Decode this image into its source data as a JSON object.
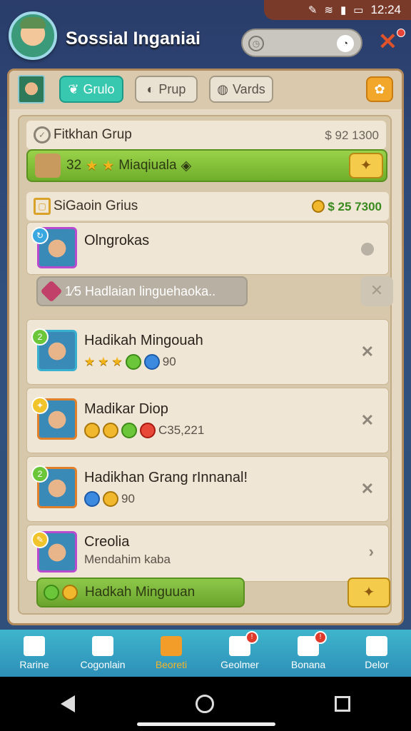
{
  "status": {
    "time": "12:24"
  },
  "header": {
    "title": "Sossial Inganiai"
  },
  "tabs": [
    {
      "label": "Grulo",
      "active": true
    },
    {
      "label": "Prup",
      "active": false
    },
    {
      "label": "Vards",
      "active": false
    }
  ],
  "section1": {
    "title": "Fitkhan Grup",
    "amount": "$ 92 1300"
  },
  "banner1": {
    "count": "32",
    "label": "Miaqiuala"
  },
  "section2": {
    "title": "SiGaoin Grius",
    "amount": "25 7300",
    "currency": "$"
  },
  "rows": [
    {
      "name": "Olngrokas",
      "sub": ""
    },
    {
      "name": "Hadikah Mingouah",
      "sub": "90"
    },
    {
      "name": "Madikar Diop",
      "sub": "C35,221"
    },
    {
      "name": "Hadikhan Grang rInnanal!",
      "sub": "90"
    },
    {
      "name": "Creolia",
      "sub": "Mendahim kaba"
    }
  ],
  "notice": {
    "text": "1⁄5 Hadlaian linguehaoka.."
  },
  "banner2": {
    "label": "Hadkah Minguuan"
  },
  "nav": [
    {
      "label": "Rarine",
      "icon": "home-icon",
      "active": false,
      "badge": ""
    },
    {
      "label": "Cogonlain",
      "icon": "community-icon",
      "active": false,
      "badge": ""
    },
    {
      "label": "Beoreti",
      "icon": "shop-icon",
      "active": true,
      "badge": ""
    },
    {
      "label": "Geolmer",
      "icon": "inbox-icon",
      "active": false,
      "badge": "!"
    },
    {
      "label": "Bonana",
      "icon": "gift-icon",
      "active": false,
      "badge": "!"
    },
    {
      "label": "Delor",
      "icon": "menu-icon",
      "active": false,
      "badge": ""
    }
  ],
  "colors": {
    "accent": "#38c8b0",
    "green": "#8cc63f",
    "navbar": "#3fb5cc"
  }
}
